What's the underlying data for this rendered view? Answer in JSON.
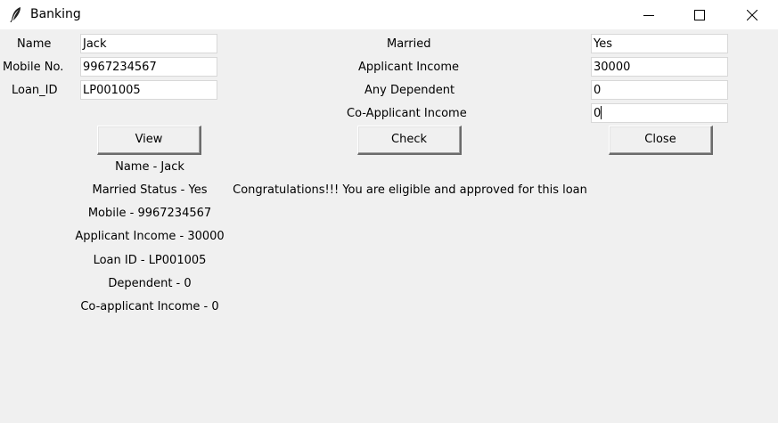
{
  "window": {
    "title": "Banking"
  },
  "form": {
    "name_label": "Name",
    "name_value": "Jack",
    "mobile_label": "Mobile No.",
    "mobile_value": "9967234567",
    "loan_id_label": "Loan_ID",
    "loan_id_value": "LP001005",
    "married_label": "Married",
    "married_value": "Yes",
    "applicant_income_label": "Applicant Income",
    "applicant_income_value": "30000",
    "dependent_label": "Any Dependent",
    "dependent_value": "0",
    "coapplicant_income_label": "Co-Applicant Income",
    "coapplicant_income_value": "0"
  },
  "buttons": {
    "view": "View",
    "check": "Check",
    "close": "Close"
  },
  "results": {
    "name": "Name - Jack",
    "married": "Married Status - Yes",
    "mobile": "Mobile - 9967234567",
    "applicant_income": "Applicant Income - 30000",
    "loan_id": "Loan ID - LP001005",
    "dependent": "Dependent - 0",
    "coapplicant_income": "Co-applicant Income - 0"
  },
  "message": "Congratulations!!! You are eligible and approved for this loan",
  "icons": {
    "app": "feather-icon",
    "minimize": "minimize-icon",
    "maximize": "maximize-icon",
    "close": "close-icon"
  }
}
